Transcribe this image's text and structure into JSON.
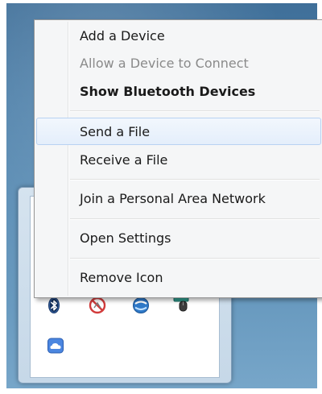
{
  "context_menu": {
    "items": [
      {
        "label": "Add a Device",
        "state": "enabled"
      },
      {
        "label": "Allow a Device to Connect",
        "state": "disabled"
      },
      {
        "label": "Show Bluetooth Devices",
        "state": "default-bold"
      },
      {
        "label": "Send a File",
        "state": "highlighted"
      },
      {
        "label": "Receive a File",
        "state": "enabled"
      },
      {
        "label": "Join a Personal Area Network",
        "state": "enabled"
      },
      {
        "label": "Open Settings",
        "state": "enabled"
      },
      {
        "label": "Remove Icon",
        "state": "enabled"
      }
    ]
  },
  "tray_flyout": {
    "icons": [
      {
        "name": "bluetooth-icon"
      },
      {
        "name": "no-network-icon"
      },
      {
        "name": "sync-icon"
      },
      {
        "name": "keyboard-mouse-icon"
      },
      {
        "name": "cloud-icon"
      }
    ]
  },
  "colors": {
    "highlight_border": "#b8d2f2",
    "disabled_text": "#8a8a8a",
    "menu_background": "#f5f6f7"
  }
}
